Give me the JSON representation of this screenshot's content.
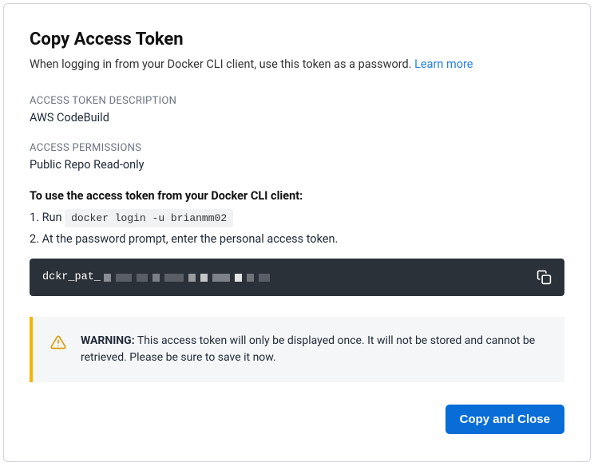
{
  "title": "Copy Access Token",
  "subtitle_prefix": "When logging in from your Docker CLI client, use this token as a password. ",
  "learn_more": "Learn more",
  "description": {
    "label": "ACCESS TOKEN DESCRIPTION",
    "value": "AWS CodeBuild"
  },
  "permissions": {
    "label": "ACCESS PERMISSIONS",
    "value": "Public Repo Read-only"
  },
  "instructions": {
    "heading": "To use the access token from your Docker CLI client:",
    "step1_prefix": "1. Run ",
    "step1_code": "docker login -u brianmm02",
    "step2": "2. At the password prompt, enter the personal access token."
  },
  "token": {
    "prefix": "dckr_pat_"
  },
  "warning": {
    "label": "WARNING:",
    "text": " This access token will only be displayed once. It will not be stored and cannot be retrieved. Please be sure to save it now."
  },
  "buttons": {
    "copy_close": "Copy and Close"
  }
}
